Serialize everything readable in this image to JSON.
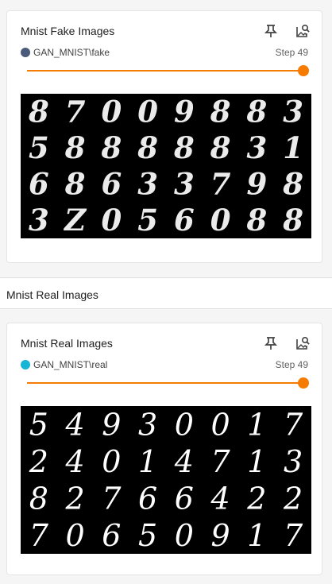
{
  "cards": [
    {
      "title": "Mnist Fake Images",
      "run_name": "GAN_MNIST\\fake",
      "run_color": "#4a5a7a",
      "step_label": "Step 49",
      "slider_value": 1.0,
      "image_alt": "generated digit grid"
    },
    {
      "title": "Mnist Real Images",
      "run_name": "GAN_MNIST\\real",
      "run_color": "#16b5d3",
      "step_label": "Step 49",
      "slider_value": 1.0,
      "image_alt": "real digit grid"
    }
  ],
  "section": {
    "title": "Mnist Real Images"
  },
  "colors": {
    "accent": "#f57c00",
    "card_bg": "#ffffff",
    "page_bg": "#f5f5f5"
  },
  "icons": [
    "pin-icon",
    "image-search-icon"
  ],
  "digit_grids": {
    "fake": [
      [
        "8",
        "7",
        "0",
        "0",
        "9",
        "8",
        "8",
        "3"
      ],
      [
        "5",
        "8",
        "8",
        "8",
        "8",
        "8",
        "3",
        "1"
      ],
      [
        "6",
        "8",
        "6",
        "3",
        "3",
        "7",
        "9",
        "8"
      ],
      [
        "3",
        "Z",
        "0",
        "5",
        "6",
        "0",
        "8",
        "8"
      ]
    ],
    "real": [
      [
        "5",
        "4",
        "9",
        "3",
        "0",
        "0",
        "1",
        "7"
      ],
      [
        "2",
        "4",
        "0",
        "1",
        "4",
        "7",
        "1",
        "3"
      ],
      [
        "8",
        "2",
        "7",
        "6",
        "6",
        "4",
        "2",
        "2"
      ],
      [
        "7",
        "0",
        "6",
        "5",
        "0",
        "9",
        "1",
        "7"
      ]
    ]
  }
}
